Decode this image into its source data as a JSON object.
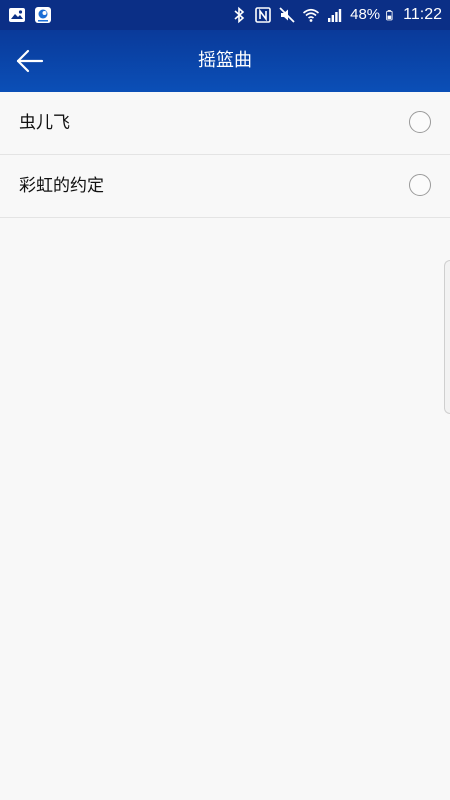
{
  "status_bar": {
    "battery": "48%",
    "time": "11:22",
    "icons": [
      "gallery-icon",
      "app-notification-icon",
      "bluetooth-icon",
      "nfc-icon",
      "mute-icon",
      "wifi-icon",
      "signal-icon",
      "battery-icon"
    ],
    "background": "#0b2f86"
  },
  "app_bar": {
    "title": "摇篮曲",
    "back_icon": "back-arrow-icon",
    "background": "#0b4fb7"
  },
  "list": {
    "items": [
      {
        "label": "虫儿飞",
        "selected": false
      },
      {
        "label": "彩虹的约定",
        "selected": false
      }
    ]
  }
}
